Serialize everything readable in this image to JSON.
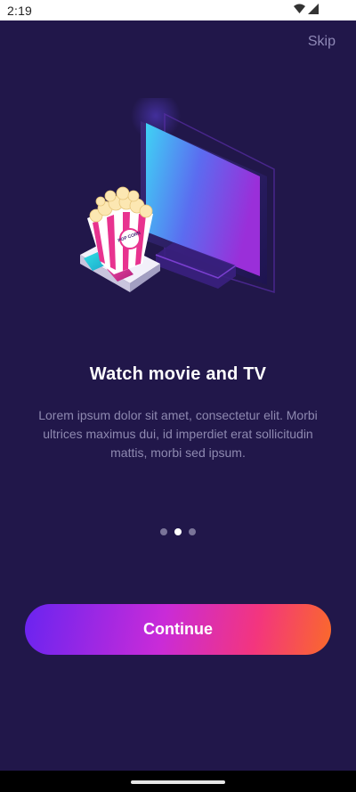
{
  "status_bar": {
    "time": "2:19",
    "icons": [
      "wifi-icon",
      "signal-icon"
    ]
  },
  "skip_label": "Skip",
  "illustration": {
    "icons": [
      "tv-icon",
      "popcorn-icon",
      "3d-glasses-icon"
    ],
    "popcorn_label": "POP CORN"
  },
  "title": "Watch movie and TV",
  "description": "Lorem ipsum dolor sit amet, consectetur elit. Morbi ultrices maximus dui, id imperdiet erat sollicitudin mattis, morbi sed ipsum.",
  "pager": {
    "total": 3,
    "active_index": 1
  },
  "continue_label": "Continue",
  "colors": {
    "background": "#21174a",
    "button_gradient": [
      "#6a24f0",
      "#c92bd8",
      "#f3357e",
      "#fa6a2a"
    ],
    "text_muted": "#8e89b0"
  }
}
